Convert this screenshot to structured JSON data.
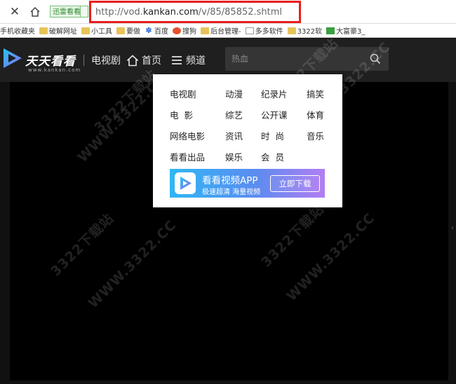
{
  "browser": {
    "url_prefix": "http://vod.",
    "url_domain": "kankan.com",
    "url_path": "/v/85/85852.shtml",
    "ext_label": "迅雷看看"
  },
  "bookmarks": [
    {
      "label": "手机收藏夹",
      "icon": "none"
    },
    {
      "label": "破解网址",
      "icon": "folder"
    },
    {
      "label": "小工具",
      "icon": "folder"
    },
    {
      "label": "要做",
      "icon": "folder"
    },
    {
      "label": "百度",
      "icon": "baidu-paw"
    },
    {
      "label": "搜狗",
      "icon": "sogou"
    },
    {
      "label": "后台管理-",
      "icon": "folder-doc"
    },
    {
      "label": "多多软件",
      "icon": "doc"
    },
    {
      "label": "3322软",
      "icon": "folder-doc"
    },
    {
      "label": "大富豪3_",
      "icon": "grid"
    }
  ],
  "header": {
    "logo_text": "天天看看",
    "logo_sub": "www.kankan.com",
    "tv_link": "电视剧",
    "home_link": "首页",
    "channel_link": "频道",
    "search_placeholder": "热血"
  },
  "menu": {
    "rows": [
      [
        "电视剧",
        "动漫",
        "纪录片",
        "搞笑"
      ],
      [
        "电  影",
        "综艺",
        "公开课",
        "体育"
      ],
      [
        "网络电影",
        "资讯",
        "时  尚",
        "音乐"
      ],
      [
        "看看出品",
        "娱乐",
        "会  员"
      ]
    ],
    "app_title": "看看视频APP",
    "app_sub": "极速超清 海量视频",
    "app_button": "立即下载"
  },
  "watermark": {
    "text_cn": "3322下载站",
    "text_en": "WWW.3322.CC"
  },
  "colors": {
    "url_highlight": "#e81e1e",
    "header_bg": "#1f1f1f",
    "player_bg": "#000000"
  }
}
